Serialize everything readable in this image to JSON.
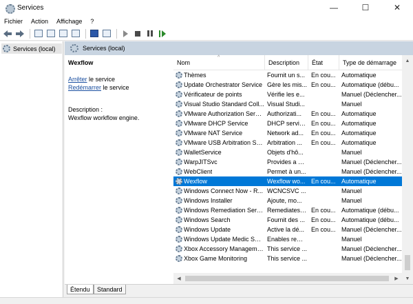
{
  "window": {
    "title": "Services",
    "controls": {
      "minimize": "—",
      "maximize": "☐",
      "close": "✕"
    }
  },
  "menu": {
    "items": [
      "Fichier",
      "Action",
      "Affichage",
      "?"
    ]
  },
  "tree": {
    "root_label": "Services (local)"
  },
  "content": {
    "header": "Services (local)",
    "detail": {
      "service_name": "Wexflow",
      "stop_link": "Arrêter",
      "stop_suffix": " le service",
      "restart_link": "Redémarrer",
      "restart_suffix": " le service",
      "description_label": "Description :",
      "description_text": "Wexflow workflow engine."
    },
    "columns": [
      "Nom",
      "Description",
      "État",
      "Type de démarrage"
    ],
    "rows": [
      {
        "name": "Thèmes",
        "desc": "Fournit un s...",
        "state": "En cou...",
        "type": "Automatique"
      },
      {
        "name": "Update Orchestrator Service",
        "desc": "Gère les mis...",
        "state": "En cou...",
        "type": "Automatique (débu..."
      },
      {
        "name": "Vérificateur de points",
        "desc": "Vérifie les e...",
        "state": "",
        "type": "Manuel (Déclencher..."
      },
      {
        "name": "Visual Studio Standard Coll...",
        "desc": "Visual Studi...",
        "state": "",
        "type": "Manuel"
      },
      {
        "name": "VMware Authorization Servi...",
        "desc": "Authorizati...",
        "state": "En cou...",
        "type": "Automatique"
      },
      {
        "name": "VMware DHCP Service",
        "desc": "DHCP servic...",
        "state": "En cou...",
        "type": "Automatique"
      },
      {
        "name": "VMware NAT Service",
        "desc": "Network ad...",
        "state": "En cou...",
        "type": "Automatique"
      },
      {
        "name": "VMware USB Arbitration Ser...",
        "desc": "Arbitration ...",
        "state": "En cou...",
        "type": "Automatique"
      },
      {
        "name": "WalletService",
        "desc": "Objets d'hô...",
        "state": "",
        "type": "Manuel"
      },
      {
        "name": "WarpJITSvc",
        "desc": "Provides a JI...",
        "state": "",
        "type": "Manuel (Déclencher..."
      },
      {
        "name": "WebClient",
        "desc": "Permet à un...",
        "state": "",
        "type": "Manuel (Déclencher..."
      },
      {
        "name": "Wexflow",
        "desc": "Wexflow wo...",
        "state": "En cou...",
        "type": "Automatique",
        "selected": true
      },
      {
        "name": "Windows Connect Now - R...",
        "desc": "WCNCSVC ...",
        "state": "",
        "type": "Manuel"
      },
      {
        "name": "Windows Installer",
        "desc": "Ajoute, mo...",
        "state": "",
        "type": "Manuel"
      },
      {
        "name": "Windows Remediation Servi...",
        "desc": "Remediates ...",
        "state": "En cou...",
        "type": "Automatique (débu..."
      },
      {
        "name": "Windows Search",
        "desc": "Fournit des ...",
        "state": "En cou...",
        "type": "Automatique (débu..."
      },
      {
        "name": "Windows Update",
        "desc": "Active la dé...",
        "state": "En cou...",
        "type": "Manuel (Déclencher..."
      },
      {
        "name": "Windows Update Medic Ser...",
        "desc": "Enables rem...",
        "state": "",
        "type": "Manuel"
      },
      {
        "name": "Xbox Accessory Manageme...",
        "desc": "This service ...",
        "state": "",
        "type": "Manuel (Déclencher..."
      },
      {
        "name": "Xbox Game Monitoring",
        "desc": "This service ...",
        "state": "",
        "type": "Manuel (Déclencher..."
      }
    ],
    "tabs": [
      "Étendu",
      "Standard"
    ]
  },
  "icons": {
    "back": "back-arrow-icon",
    "forward": "forward-arrow-icon",
    "service": "gear-icon"
  },
  "colors": {
    "selection": "#0078d7",
    "header_band": "#c8d4e1",
    "link": "#1a4fa0"
  }
}
